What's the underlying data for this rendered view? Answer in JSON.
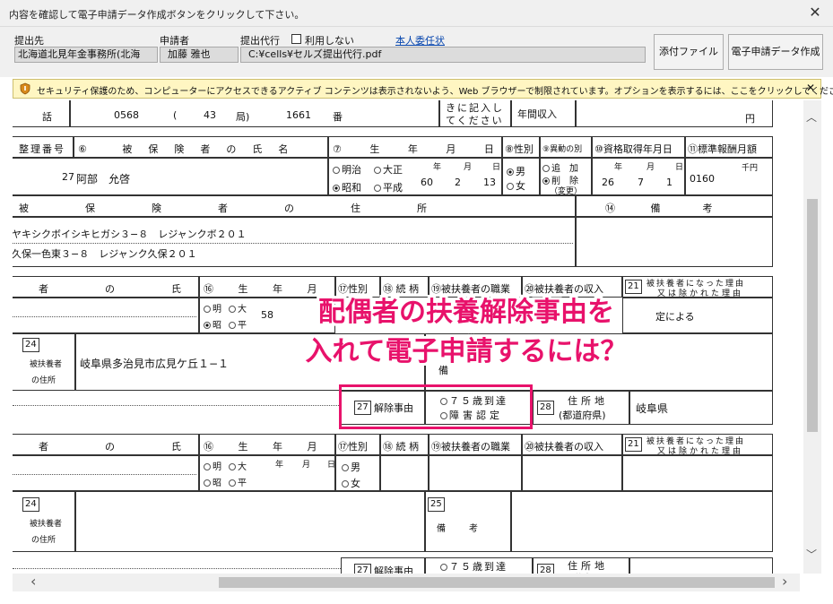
{
  "window": {
    "title": "内容を確認して電子申請データ作成ボタンをクリックして下さい。",
    "close": "✕"
  },
  "header": {
    "submit_to_label": "提出先",
    "submit_to_value": "北海道北見年金事務所(北海",
    "applicant_label": "申請者",
    "applicant_value": "加藤 雅也",
    "proxy_label": "提出代行",
    "no_use_label": "利用しない",
    "proxy_file": "C:¥cells¥セルズ提出代行.pdf",
    "delegation_link": "本人委任状",
    "attach_button": "添付ファイル",
    "create_button": "電子申請データ作成"
  },
  "infobar": {
    "message": "セキュリティ保護のため、コンピューターにアクセスできるアクティブ コンテンツは表示されないよう、Web ブラウザーで制限されています。オプションを表示するには、ここをクリックしてください...",
    "close": "✕"
  },
  "form": {
    "tel_label": "話",
    "tel_area": "0568",
    "tel_paren_open": "(",
    "tel_mid": "43",
    "tel_local_label": "局)",
    "tel_num": "1661",
    "tel_ban": "番",
    "fill_note_1": "きに記入し",
    "fill_note_2": "てください",
    "annual_income": "年間収入",
    "yen": "円",
    "col_ref_num": "整理番号",
    "col_name": "⑥ 被保険者の氏名",
    "col_birth": "⑦ 生 年 月 日",
    "col_gender": "⑧性別",
    "col_change": "⑨異動の別",
    "col_acq_date": "⑩資格取得年月日",
    "col_salary": "⑪標準報酬月額",
    "ref_num": "27",
    "insured_name": "阿部　允啓",
    "era_meiji": "明治",
    "era_taisho": "大正",
    "era_showa": "昭和",
    "era_heisei": "平成",
    "y_lbl": "年",
    "m_lbl": "月",
    "d_lbl": "日",
    "birth_y": "60",
    "birth_m": "2",
    "birth_d": "13",
    "male": "男",
    "female": "女",
    "add": "追　加",
    "remove": "削　除",
    "change_note": "（変更）",
    "acq_y": "26",
    "acq_m": "7",
    "acq_d": "1",
    "salary": "0160",
    "thousand_yen": "千円",
    "addr_header": "被　保　険　者　の　住　所",
    "remarks_header": "⑭ 備　考",
    "addr_kana": "ヤキシクボイシキヒガシ３−８　レジャンクボ２０１",
    "addr_kanji": "久保一色東３−８　レジャンク久保２０１",
    "dep_name_header": "者　の　氏　名",
    "dep_birth_header": "⑯ 生 年 月 日",
    "dep_gender_header": "⑰性別",
    "dep_relation_header": "⑱ 続 柄",
    "dep_job_header": "⑲被扶養者の職業",
    "dep_income_header": "⑳被扶養者の収入",
    "dep_reason_num": "21",
    "dep_reason_header_1": "被扶養者になった理由",
    "dep_reason_header_2": "又は除かれた理由",
    "era_m": "明",
    "era_t": "大",
    "era_s": "昭",
    "era_h": "平",
    "dep_birth_y": "58",
    "dep_reason_value": "定による",
    "dep_addr_num": "24",
    "dep_addr_label_1": "被扶養者",
    "dep_addr_label_2": "の住所",
    "dep_addr_value": "岐阜県多治見市広見ケ丘１−１",
    "remark_num": "25",
    "remark_label": "備　考",
    "remark_short": "備",
    "removal_num": "27",
    "removal_label": "解除事由",
    "removal_opt1": "７５歳到達",
    "removal_opt2": "障害認定",
    "pref_num": "28",
    "pref_label_1": "住所地",
    "pref_label_2": "(都道府県)",
    "pref_value": "岐阜県"
  },
  "overlay": {
    "line1": "配偶者の扶養解除事由を",
    "line2": "入れて電子申請するには？",
    "color": "#e8126b"
  },
  "scroll": {
    "up": "︿",
    "down": "﹀",
    "left": "‹",
    "right": "›"
  }
}
